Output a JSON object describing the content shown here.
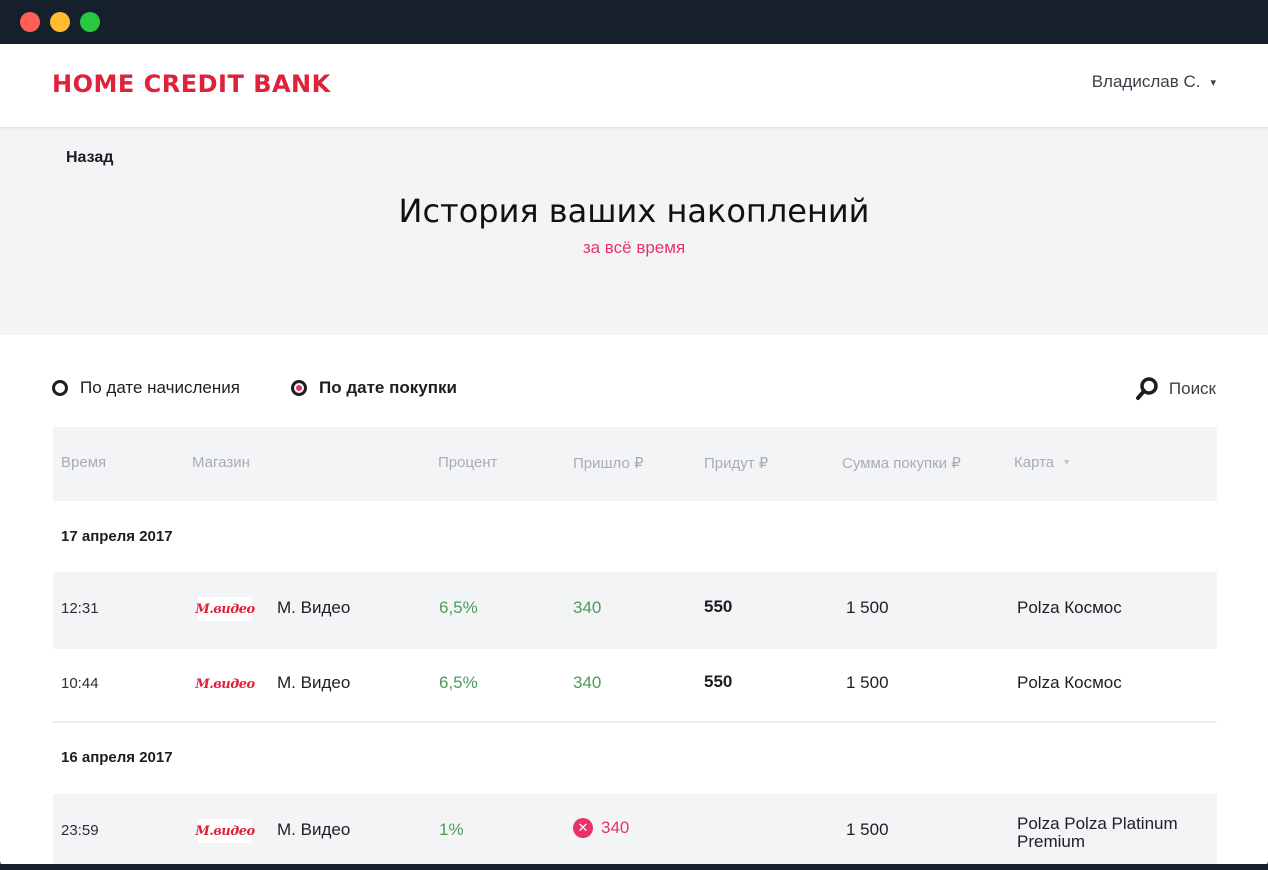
{
  "header": {
    "logo_text": "HOME CREDIT BANK",
    "user_name": "Владислав С.",
    "user_caret": "▾"
  },
  "hero": {
    "back_label": "Назад",
    "title": "История ваших накоплений",
    "subtitle": "за всё время"
  },
  "filters": {
    "options": [
      {
        "label": "По дате начисления",
        "checked": false
      },
      {
        "label": "По дате покупки",
        "checked": true
      }
    ],
    "search_label": "Поиск"
  },
  "table": {
    "columns": [
      "Время",
      "Магазин",
      "Процент",
      "Пришло ₽",
      "Придут ₽",
      "Сумма покупки ₽",
      "Карта"
    ],
    "sort_icon": "▼",
    "groups": [
      {
        "date": "17 апреля 2017",
        "rows": [
          {
            "time": "12:31",
            "logo": "М.видео",
            "shop": "М. Видео",
            "percent": "6,5%",
            "came": "340",
            "came_failed": false,
            "will": "550",
            "sum": "1 500",
            "card": "Polza Космос"
          },
          {
            "time": "10:44",
            "logo": "М.видео",
            "shop": "М. Видео",
            "percent": "6,5%",
            "came": "340",
            "came_failed": false,
            "will": "550",
            "sum": "1 500",
            "card": "Polza Космос"
          }
        ]
      },
      {
        "date": "16 апреля 2017",
        "rows": [
          {
            "time": "23:59",
            "logo": "М.видео",
            "shop": "М. Видео",
            "percent": "1%",
            "came": "340",
            "came_failed": true,
            "will": "",
            "sum": "1 500",
            "card": "Polza Polza Platinum Premium"
          }
        ]
      }
    ]
  },
  "colors": {
    "brand": "#e0213b",
    "accent": "#e8336a",
    "positive": "#4d9a5c"
  }
}
